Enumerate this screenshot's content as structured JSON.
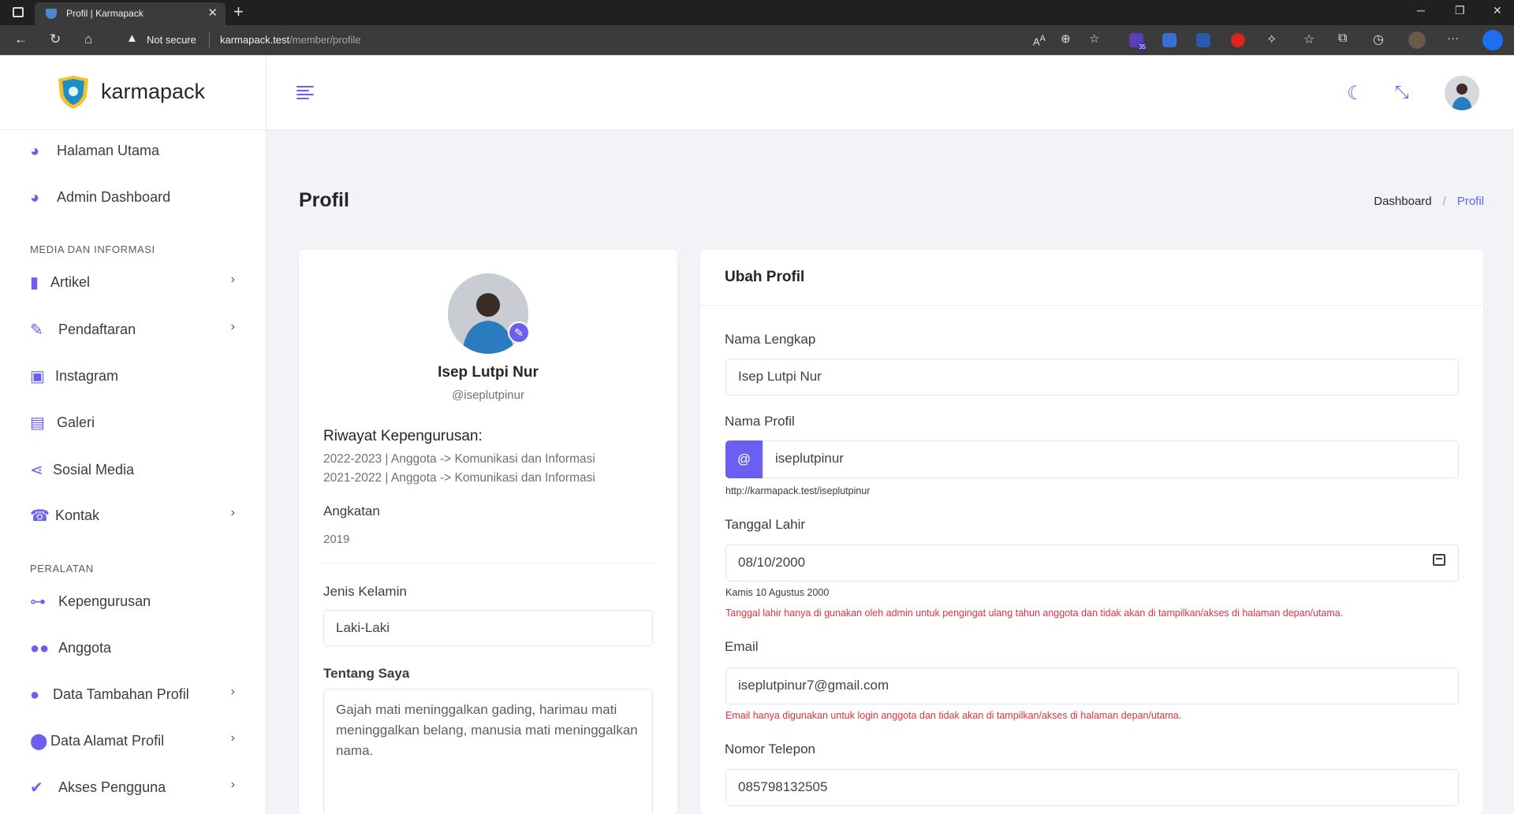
{
  "browser": {
    "tab_title": "Profil | Karmapack",
    "tab_close": "✕",
    "new_tab": "+",
    "security_label": "Not secure",
    "url_host": "karmapack.test",
    "url_path": "/member/profile",
    "extension_badge": "35"
  },
  "sidebar": {
    "brand": "karmapack",
    "items_main": [
      {
        "label": "Halaman Utama",
        "icon": "dashboard-icon"
      },
      {
        "label": "Admin Dashboard",
        "icon": "dashboard-icon"
      }
    ],
    "section_media": "MEDIA DAN INFORMASI",
    "items_media": [
      {
        "label": "Artikel",
        "icon": "file-icon",
        "has_submenu": true
      },
      {
        "label": "Pendaftaran",
        "icon": "user-edit-icon",
        "has_submenu": true
      },
      {
        "label": "Instagram",
        "icon": "image-icon",
        "has_submenu": false
      },
      {
        "label": "Galeri",
        "icon": "images-icon",
        "has_submenu": false
      },
      {
        "label": "Sosial Media",
        "icon": "share-icon",
        "has_submenu": false
      },
      {
        "label": "Kontak",
        "icon": "phone-icon",
        "has_submenu": true
      }
    ],
    "section_tools": "PERALATAN",
    "items_tools": [
      {
        "label": "Kepengurusan",
        "icon": "sitemap-icon",
        "has_submenu": false
      },
      {
        "label": "Anggota",
        "icon": "users-icon",
        "has_submenu": false
      },
      {
        "label": "Data Tambahan Profil",
        "icon": "user-icon",
        "has_submenu": true
      },
      {
        "label": "Data Alamat Profil",
        "icon": "map-marker-icon",
        "has_submenu": true
      },
      {
        "label": "Akses Pengguna",
        "icon": "user-check-icon",
        "has_submenu": true
      }
    ]
  },
  "page": {
    "title": "Profil",
    "breadcrumb": [
      "Dashboard",
      "Profil"
    ]
  },
  "profile_card": {
    "name": "Isep Lutpi Nur",
    "username": "@iseplutpinur",
    "history_title": "Riwayat Kepengurusan:",
    "history": [
      "2022-2023 | Anggota -> Komunikasi dan Informasi",
      "2021-2022 | Anggota -> Komunikasi dan Informasi"
    ],
    "angkatan_label": "Angkatan",
    "angkatan_value": "2019",
    "gender_label": "Jenis Kelamin",
    "gender_value": "Laki-Laki",
    "about_label": "Tentang Saya",
    "about_value": "Gajah mati meninggalkan gading, harimau mati meninggalkan belang, manusia mati meninggalkan nama."
  },
  "edit_form": {
    "title": "Ubah Profil",
    "fullname_label": "Nama Lengkap",
    "fullname_value": "Isep Lutpi Nur",
    "profile_name_label": "Nama Profil",
    "at_symbol": "@",
    "profile_name_value": "iseplutpinur",
    "profile_url": "http://karmapack.test/iseplutpinur",
    "birthdate_label": "Tanggal Lahir",
    "birthdate_value": "08/10/2000",
    "birthdate_readable": "Kamis 10 Agustus 2000",
    "birthdate_note": "Tanggal lahir hanya di gunakan oleh admin untuk pengingat ulang tahun anggota dan tidak akan di tampilkan/akses di halaman depan/utama.",
    "email_label": "Email",
    "email_value": "iseplutpinur7@gmail.com",
    "email_note": "Email hanya digunakan untuk login anggota dan tidak akan di tampilkan/akses di halaman depan/utama.",
    "phone_label": "Nomor Telepon",
    "phone_value": "085798132505"
  },
  "colors": {
    "accent": "#6b5ff2",
    "warning_text": "#e0323f"
  }
}
